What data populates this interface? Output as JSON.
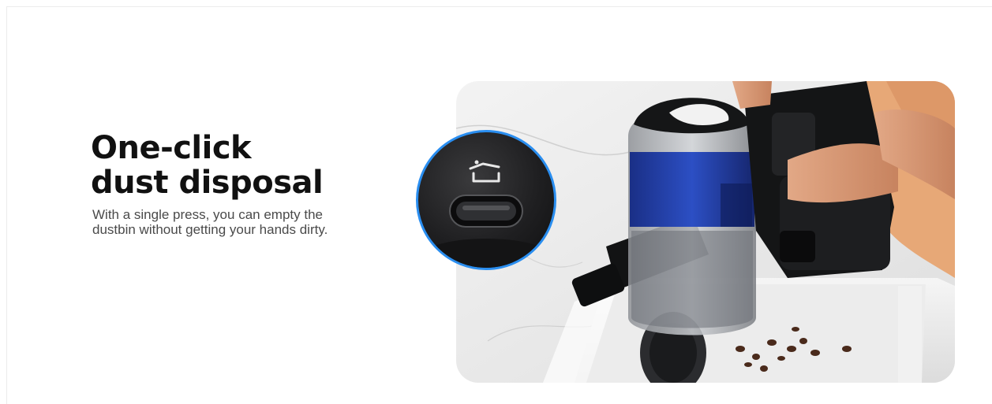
{
  "feature": {
    "title_line1": "One-click",
    "title_line2": "dust disposal",
    "description_line1": "With a single press, you can empty the",
    "description_line2": "dustbin without getting your hands dirty."
  },
  "colors": {
    "accent_ring": "#2a8ef0",
    "dustbin_blue": "#1f3fa8",
    "heading": "#111111",
    "body_text": "#4a4a4a"
  },
  "images": {
    "main_photo": "vacuum-emptying-dustbin-over-sink",
    "zoom_photo": "dust-release-button-closeup",
    "button_icon": "dustbin-open-icon"
  }
}
